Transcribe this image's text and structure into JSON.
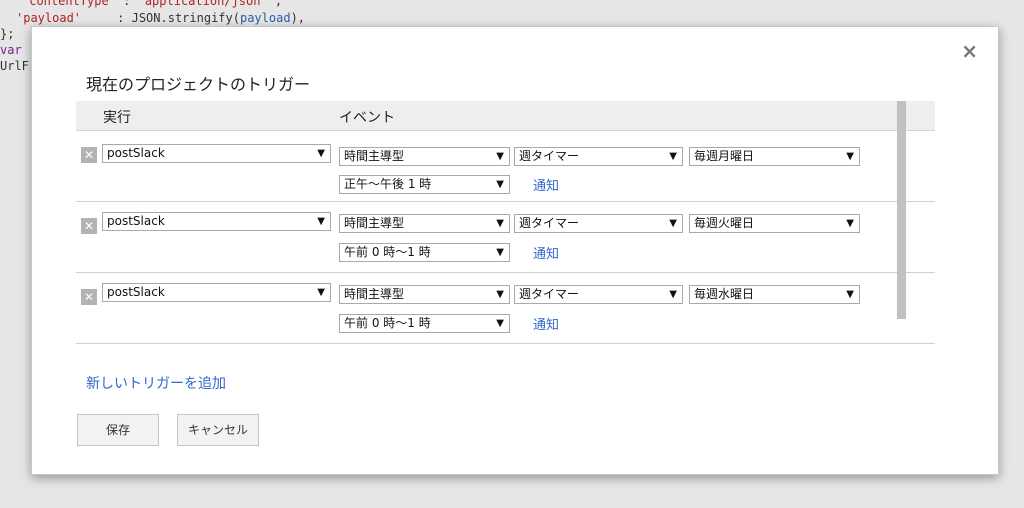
{
  "background_code": {
    "lines": [
      {
        "key": "'contentType'",
        "sep": " : ",
        "value": "'application/json'",
        "tail": " ,"
      },
      {
        "key": "'payload'",
        "sep": "     : JSON.stringify(",
        "value": "payload",
        "tail": "),"
      },
      {
        "text": "};"
      },
      {
        "text": "var"
      },
      {
        "text": "UrlF"
      }
    ]
  },
  "dialog": {
    "title": "現在のプロジェクトのトリガー",
    "close_label": "×",
    "table": {
      "headers": [
        "実行",
        "イベント"
      ],
      "rows": [
        {
          "function": "postSlack",
          "event_source": "時間主導型",
          "timer_type": "週タイマー",
          "day": "毎週月曜日",
          "time": "正午〜午後 1 時",
          "notify": "通知"
        },
        {
          "function": "postSlack",
          "event_source": "時間主導型",
          "timer_type": "週タイマー",
          "day": "毎週火曜日",
          "time": "午前 0 時〜1 時",
          "notify": "通知"
        },
        {
          "function": "postSlack",
          "event_source": "時間主導型",
          "timer_type": "週タイマー",
          "day": "毎週水曜日",
          "time": "午前 0 時〜1 時",
          "notify": "通知"
        }
      ]
    },
    "add_trigger_label": "新しいトリガーを追加",
    "save_label": "保存",
    "cancel_label": "キャンセル"
  },
  "icons": {
    "delete": "close-box-icon",
    "dropdown": "triangle-down-icon"
  },
  "colors": {
    "link": "#3366cc",
    "overlay": "#e6e6e6"
  }
}
